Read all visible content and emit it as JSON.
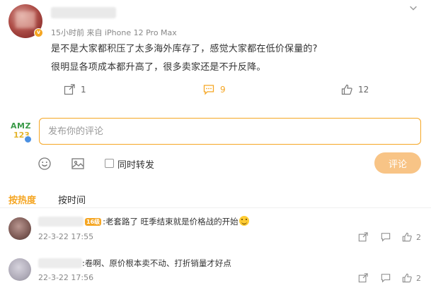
{
  "post": {
    "meta": "15小时前  来自 iPhone 12 Pro Max",
    "lines": [
      "是不是大家都积压了太多海外库存了，感觉大家都在低价保量的?",
      "很明显各项成本都升高了，很多卖家还是不升反降。"
    ],
    "actions": {
      "repost_count": "1",
      "comment_count": "9",
      "like_count": "12"
    },
    "author_badge": "v"
  },
  "composer": {
    "avatar_text_top": "AMZ",
    "avatar_text_bottom": "123",
    "placeholder": "发布你的评论",
    "repost_label": "同时转发",
    "submit_label": "评论"
  },
  "sort": {
    "tabs": [
      "按热度",
      "按时间"
    ]
  },
  "comments": [
    {
      "badge": "16级",
      "text": ":老套路了 旺季结束就是价格战的开始",
      "time": "22-3-22 17:55",
      "like_count": "2"
    },
    {
      "text": ":卷啊、原价根本卖不动、打折销量才好点",
      "time": "22-3-22 17:56",
      "like_count": "2"
    }
  ],
  "colors": {
    "accent": "#f5a623",
    "submit_bg": "#f8c486",
    "verified_blue": "#4a90e2"
  }
}
